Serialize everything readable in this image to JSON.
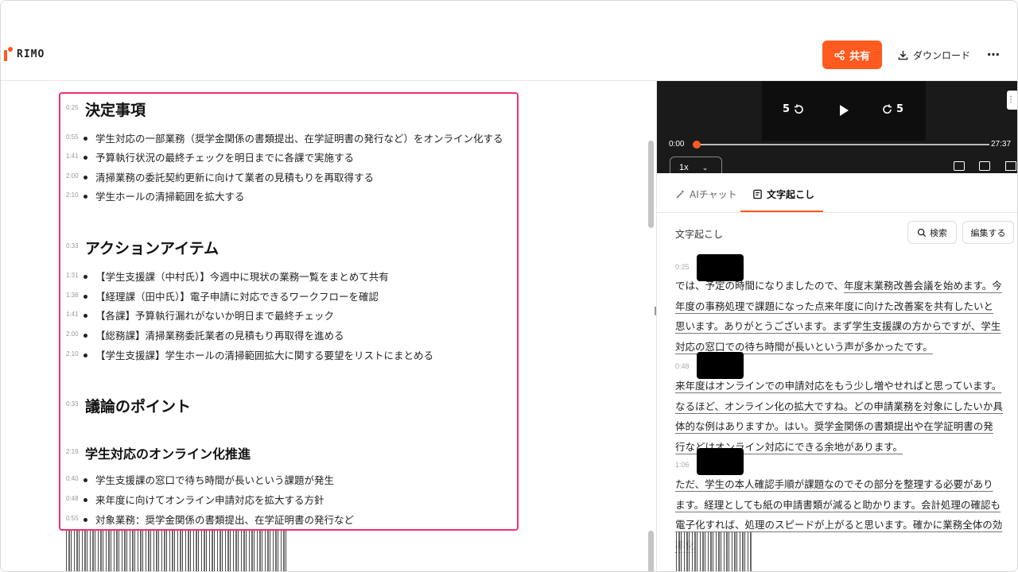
{
  "app": {
    "logo_text": "RIMO"
  },
  "header": {
    "share_label": "共有",
    "download_label": "ダウンロード",
    "more_label": "⋯"
  },
  "document": {
    "sections": [
      {
        "title_ts": "0:25",
        "title": "決定事項",
        "items": [
          {
            "ts": "0:55",
            "text": "学生対応の一部業務（奨学金関係の書類提出、在学証明書の発行など）をオンライン化する"
          },
          {
            "ts": "1:41",
            "text": "予算執行状況の最終チェックを明日までに各課で実施する"
          },
          {
            "ts": "2:00",
            "text": "清掃業務の委託契約更新に向けて業者の見積もりを再取得する"
          },
          {
            "ts": "2:10",
            "text": "学生ホールの清掃範囲を拡大する"
          }
        ]
      },
      {
        "title_ts": "0:33",
        "title": "アクションアイテム",
        "items": [
          {
            "ts": "1:31",
            "text": "【学生支援課（中村氏）】今週中に現状の業務一覧をまとめて共有"
          },
          {
            "ts": "1:36",
            "text": "【経理課（田中氏）】電子申請に対応できるワークフローを確認"
          },
          {
            "ts": "1:41",
            "text": "【各課】予算執行漏れがないか明日まで最終チェック"
          },
          {
            "ts": "2:00",
            "text": "【総務課】清掃業務委託業者の見積もり再取得を進める"
          },
          {
            "ts": "2:10",
            "text": "【学生支援課】学生ホールの清掃範囲拡大に関する要望をリストにまとめる"
          }
        ]
      },
      {
        "title_ts": "0:33",
        "title": "議論のポイント",
        "subsection": {
          "ts": "2:19",
          "title": "学生対応のオンライン化推進",
          "items": [
            {
              "ts": "0:40",
              "text": "学生支援課の窓口で待ち時間が長いという課題が発生"
            },
            {
              "ts": "0:48",
              "text": "来年度に向けてオンライン申請対応を拡大する方針"
            },
            {
              "ts": "0:55",
              "text": "対象業務：奨学金関係の書類提出、在学証明書の発行など"
            }
          ]
        }
      }
    ]
  },
  "player": {
    "skip_back": "5",
    "skip_forward": "5",
    "time_current": "0:00",
    "time_total": "27:37",
    "speed": "1x",
    "progress": 0.0
  },
  "tabs": [
    {
      "label": "AIチャット",
      "icon": "magic-wand-icon"
    },
    {
      "label": "文字起こし",
      "icon": "transcript-icon",
      "active": true
    }
  ],
  "transcript": {
    "title": "文字起こし",
    "search_label": "検索",
    "edit_label": "編集する",
    "blocks": [
      {
        "ts": "0:25",
        "plain_prefix": "では、予定の時間になりましたので、",
        "underlined": "年度末業務改善会議を始めます。今年度の事務処理で課題になった点来年度に向けた改善案を共有したいと思います。ありがとうございます。まず学生支援課の方からですが、学生対応の窓口での待ち時間が長いという声が多かったです。"
      },
      {
        "ts": "0:48",
        "plain_prefix": "",
        "underlined": "来年度はオンラインでの申請対応をもう少し増やせればと思っています。なるほど、オンライン化の拡大ですね。どの申請業務を対象にしたいか具体的な例はありますか。はい。奨学金関係の書類提出や在学証明書の発行などはオンライン対応にできる余地があります。"
      },
      {
        "ts": "1:06",
        "plain_prefix": "",
        "underlined": "ただ、学生の本人確認手順が課題なのでその部分を整理する必要があります。経理としても紙の申請書類が減ると助かります。会計処理の確認も電子化すれば、処理のスピードが上がると思います。確かに業務全体の効率化"
      }
    ]
  },
  "colors": {
    "accent": "#ff5a1f",
    "highlight_border": "#f0306e"
  }
}
